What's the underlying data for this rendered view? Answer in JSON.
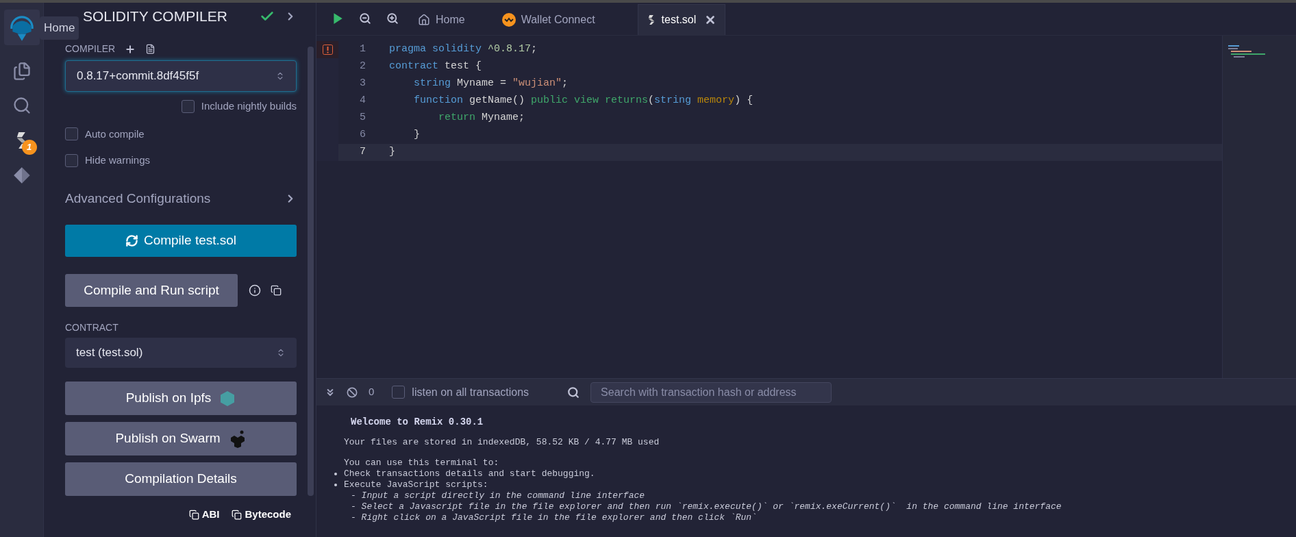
{
  "icon_bar": {
    "tooltip": "Home",
    "badge": "1"
  },
  "panel": {
    "title": "SOLIDITY COMPILER",
    "compiler_label": "COMPILER",
    "compiler_version": "0.8.17+commit.8df45f5f",
    "nightly": {
      "label": "Include nightly builds",
      "checked": false
    },
    "options": [
      {
        "label": "Auto compile",
        "checked": false
      },
      {
        "label": "Hide warnings",
        "checked": false
      }
    ],
    "advanced": "Advanced Configurations",
    "compile_button": "Compile test.sol",
    "run_button": "Compile and Run script",
    "contract_label": "CONTRACT",
    "contract": "test (test.sol)",
    "buttons": [
      {
        "label": "Publish on Ipfs",
        "kind": "ipfs"
      },
      {
        "label": "Publish on Swarm",
        "kind": "swarm"
      },
      {
        "label": "Compilation Details",
        "kind": "plain"
      }
    ],
    "copy_links": [
      "ABI",
      "Bytecode"
    ]
  },
  "tabs": [
    {
      "label": "Home",
      "kind": "home",
      "selected": false
    },
    {
      "label": "Wallet Connect",
      "kind": "wallet",
      "selected": false
    },
    {
      "label": "test.sol",
      "kind": "file",
      "selected": true
    }
  ],
  "editor": {
    "lines": [
      {
        "number": "1",
        "error": true,
        "active": false,
        "tokens": [
          {
            "kind": "kw",
            "text": "pragma solidity "
          },
          {
            "kind": "num",
            "text": "^0.8.17"
          },
          {
            "kind": "plain",
            "text": ";"
          }
        ]
      },
      {
        "number": "2",
        "error": false,
        "active": false,
        "tokens": [
          {
            "kind": "kw",
            "text": "contract "
          },
          {
            "kind": "plain",
            "text": "test {"
          }
        ]
      },
      {
        "number": "3",
        "error": false,
        "active": false,
        "tokens": [
          {
            "kind": "kw",
            "text": "    string "
          },
          {
            "kind": "plain",
            "text": "Myname = "
          },
          {
            "kind": "str",
            "text": "\"wujian\""
          },
          {
            "kind": "plain",
            "text": ";"
          }
        ]
      },
      {
        "number": "4",
        "error": false,
        "active": false,
        "tokens": [
          {
            "kind": "kw",
            "text": "    function "
          },
          {
            "kind": "plain",
            "text": "getName() "
          },
          {
            "kind": "mod",
            "text": "public view returns"
          },
          {
            "kind": "plain",
            "text": "("
          },
          {
            "kind": "kw",
            "text": "string "
          },
          {
            "kind": "loc",
            "text": "memory"
          },
          {
            "kind": "plain",
            "text": ") {"
          }
        ]
      },
      {
        "number": "5",
        "error": false,
        "active": false,
        "tokens": [
          {
            "kind": "mod",
            "text": "        return "
          },
          {
            "kind": "plain",
            "text": "Myname;"
          }
        ]
      },
      {
        "number": "6",
        "error": false,
        "active": false,
        "tokens": [
          {
            "kind": "plain",
            "text": "    }"
          }
        ]
      },
      {
        "number": "7",
        "error": false,
        "active": true,
        "tokens": [
          {
            "kind": "plain",
            "text": "}"
          }
        ]
      }
    ]
  },
  "terminal": {
    "count": "0",
    "listen": {
      "label": "listen on all transactions",
      "checked": false
    },
    "search_placeholder": "Search with transaction hash or address",
    "lines": [
      {
        "kind": "heading",
        "text": "Welcome to Remix 0.30.1"
      },
      {
        "kind": "text",
        "text": "Your files are stored in indexedDB, 58.52 KB / 4.77 MB used"
      },
      {
        "kind": "text",
        "text": "You can use this terminal to:"
      },
      {
        "kind": "bullet",
        "text": "Check transactions details and start debugging."
      },
      {
        "kind": "bullet",
        "text": "Execute JavaScript scripts:"
      },
      {
        "kind": "item",
        "text": "- Input a script directly in the command line interface"
      },
      {
        "kind": "item",
        "text": "- Select a Javascript file in the file explorer and then run `remix.execute()` or `remix.exeCurrent()`  in the command line interface"
      },
      {
        "kind": "item",
        "text": "- Right click on a JavaScript file in the file explorer and then click `Run`"
      }
    ]
  }
}
